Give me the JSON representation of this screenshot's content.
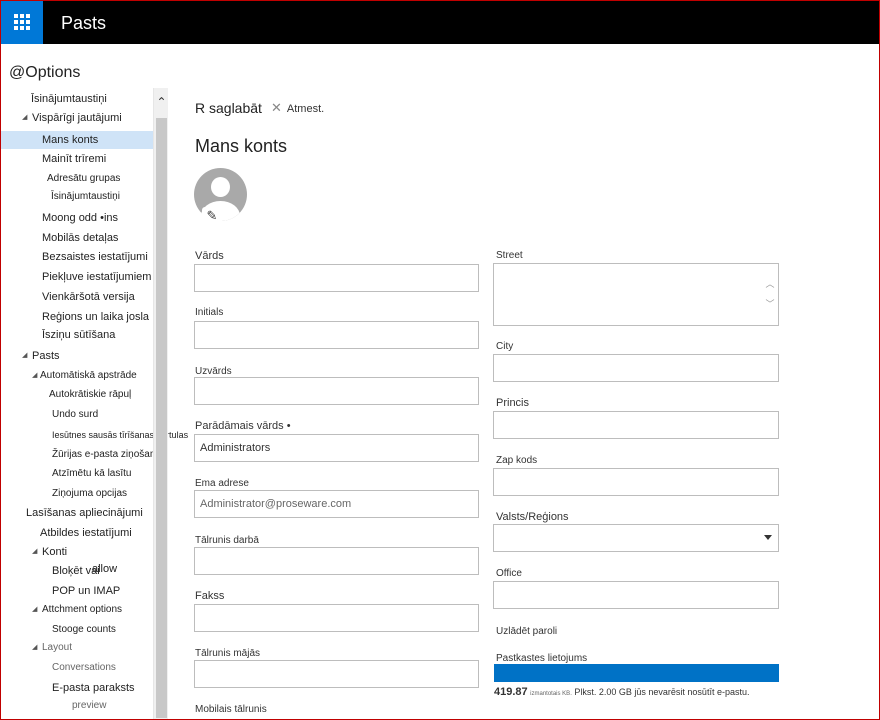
{
  "app": {
    "title": "Pasts",
    "waffle_icon": "app-launcher-icon"
  },
  "options_title": "@Options",
  "sidebar": {
    "items": [
      {
        "label": "Īsinājumtaustiņi"
      },
      {
        "label": "Vispārīgi jautājumi"
      },
      {
        "label": "Mans konts"
      },
      {
        "label": "Mainīt trīremi"
      },
      {
        "label": "Adresātu grupas"
      },
      {
        "label": "Īsinājumtaustiņi"
      },
      {
        "label": "Moong odd •ins"
      },
      {
        "label": "Mobilās detaļas"
      },
      {
        "label": "Bezsaistes iestatījumi"
      },
      {
        "label": "Piekļuve iestatījumiem"
      },
      {
        "label": "Vienkāršotā versija"
      },
      {
        "label": "Reģions un laika josla"
      },
      {
        "label": "Īsziņu sūtīšana"
      },
      {
        "label": "Pasts"
      },
      {
        "label": "Automātiskā apstrāde"
      },
      {
        "label": "Autokrātiskie rāpuļ"
      },
      {
        "label": "Undo surd"
      },
      {
        "label": "Iesūtnes sausās tīrīšanas kārtulas"
      },
      {
        "label": "Žūrijas e-pasta ziņošana"
      },
      {
        "label": "Atzīmētu kā lasītu"
      },
      {
        "label": "Ziņojuma opcijas"
      },
      {
        "label": "Lasīšanas apliecinājumi"
      },
      {
        "label": "Atbildes iestatījumi"
      },
      {
        "label": "Konti"
      },
      {
        "label": "Bloķēt vai"
      },
      {
        "label": "POP un IMAP"
      },
      {
        "label": "Attchment options"
      },
      {
        "label": "Stooge counts"
      },
      {
        "label": "Layout"
      },
      {
        "label": "Conversations"
      },
      {
        "label": "E-pasta paraksts"
      },
      {
        "label": "preview"
      }
    ],
    "ghost_label": "allow"
  },
  "toolbar": {
    "save_label": "R saglabāt",
    "discard_label": "Atmest."
  },
  "page_title": "Mans konts",
  "form": {
    "first_name": {
      "label": "Vārds",
      "value": ""
    },
    "initials": {
      "label": "Initials",
      "value": ""
    },
    "last_name": {
      "label": "Uzvārds",
      "value": ""
    },
    "display_name": {
      "label": "Parādāmais vārds •",
      "value": "Administrators"
    },
    "email": {
      "label": "Ema adrese",
      "value": "Administrator@proseware.com"
    },
    "work_phone": {
      "label": "Tālrunis darbā",
      "value": ""
    },
    "fax": {
      "label": "Fakss",
      "value": ""
    },
    "home_phone": {
      "label": "Tālrunis mājās",
      "value": ""
    },
    "mobile_phone": {
      "label": "Mobilais tālrunis"
    },
    "street": {
      "label": "Street",
      "value": ""
    },
    "city": {
      "label": "City",
      "value": ""
    },
    "province": {
      "label": "Princis",
      "value": ""
    },
    "zip": {
      "label": "Zap kods",
      "value": ""
    },
    "country": {
      "label": "Valsts/Reģions",
      "value": ""
    },
    "office": {
      "label": "Office",
      "value": ""
    },
    "change_password": {
      "label": "Uzlādēt paroli"
    },
    "mailbox_usage": {
      "label": "Pastkastes lietojums",
      "used_value": "419.87",
      "used_unit": "izmantotais KB.",
      "limit_text": "Plkst. 2.00 GB jūs nevarēsit nosūtīt e-pastu.",
      "fill_fraction": 1.0,
      "bar_color": "#0072c6"
    }
  }
}
